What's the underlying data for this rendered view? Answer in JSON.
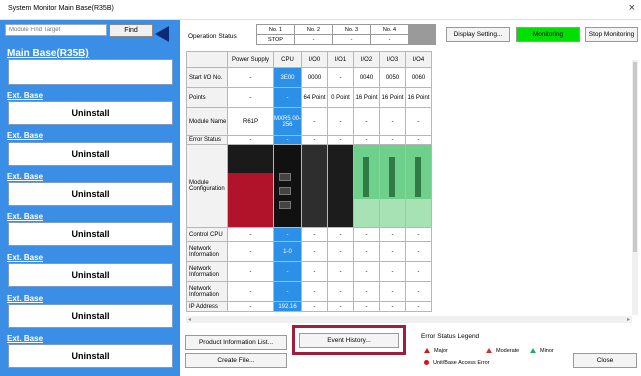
{
  "window": {
    "title": "System Monitor Main Base(R35B)",
    "close": "×"
  },
  "left": {
    "search_placeholder": "Module Find Target",
    "find_label": "Find",
    "main_base": "Main Base(R35B)",
    "ext_bases": [
      {
        "title": "Ext. Base",
        "button": "Uninstall"
      },
      {
        "title": "Ext. Base",
        "button": "Uninstall"
      },
      {
        "title": "Ext. Base",
        "button": "Uninstall"
      },
      {
        "title": "Ext. Base",
        "button": "Uninstall"
      },
      {
        "title": "Ext. Base",
        "button": "Uninstall"
      },
      {
        "title": "Ext. Base",
        "button": "Uninstall"
      },
      {
        "title": "Ext. Base",
        "button": "Uninstall"
      }
    ]
  },
  "operation_status": {
    "label": "Operation Status",
    "headers": [
      "No. 1",
      "No. 2",
      "No. 3",
      "No. 4"
    ],
    "values": [
      "STOP",
      "-",
      "-",
      "-"
    ]
  },
  "toolbar": {
    "display_setting": "Display Setting...",
    "monitoring": "Monitoring",
    "stop_monitoring": "Stop Monitoring"
  },
  "grid": {
    "columns": [
      "",
      "Power Supply",
      "CPU",
      "I/O0",
      "I/O1",
      "I/O2",
      "I/O3",
      "I/O4"
    ],
    "rows": [
      {
        "label": "Start I/O No.",
        "cells": [
          "-",
          "3E00",
          "0000",
          "-",
          "0040",
          "0050",
          "0060"
        ]
      },
      {
        "label": "Points",
        "cells": [
          "-",
          "-",
          "64 Point",
          "0 Point",
          "16 Point",
          "16 Point",
          "16 Point"
        ]
      },
      {
        "label": "Module Name",
        "cells": [
          "R61P",
          "MXR5 00-256",
          "-",
          "-",
          "-",
          "-",
          "-"
        ]
      },
      {
        "label": "Error Status",
        "cells": [
          "-",
          "-",
          "-",
          "-",
          "-",
          "-",
          "-"
        ]
      },
      {
        "label": "Module Configuration",
        "cells": [
          "",
          "",
          "",
          "",
          "",
          "",
          ""
        ]
      },
      {
        "label": "Control CPU",
        "cells": [
          "-",
          "-",
          "-",
          "-",
          "-",
          "-",
          "-"
        ]
      },
      {
        "label": "Network Information",
        "cells": [
          "-",
          "1-0",
          "-",
          "-",
          "-",
          "-",
          "-"
        ]
      },
      {
        "label": "Network Information",
        "cells": [
          "-",
          "-",
          "-",
          "-",
          "-",
          "-",
          "-"
        ]
      },
      {
        "label": "Network Information",
        "cells": [
          "-",
          "-",
          "-",
          "-",
          "-",
          "-",
          "-"
        ]
      },
      {
        "label": "IP Address",
        "cells": [
          "-",
          "192.16",
          "-",
          "-",
          "-",
          "-",
          "-"
        ]
      }
    ]
  },
  "bottom": {
    "product_info": "Product Information List...",
    "create_file": "Create File...",
    "event_history": "Event History...",
    "close": "Close"
  },
  "legend": {
    "title": "Error Status Legend",
    "major": "Major",
    "moderate": "Moderate",
    "minor": "Minor",
    "unit_error": "Unit/Base Access Error",
    "colors": {
      "major": "#d11a1a",
      "moderate": "#c0392b",
      "minor": "#27ae60"
    }
  },
  "colors": {
    "left_panel": "#3a8ee6",
    "cpu_column": "#2c8fe8",
    "monitoring_active": "#00e000",
    "highlight": "#a0203c"
  }
}
